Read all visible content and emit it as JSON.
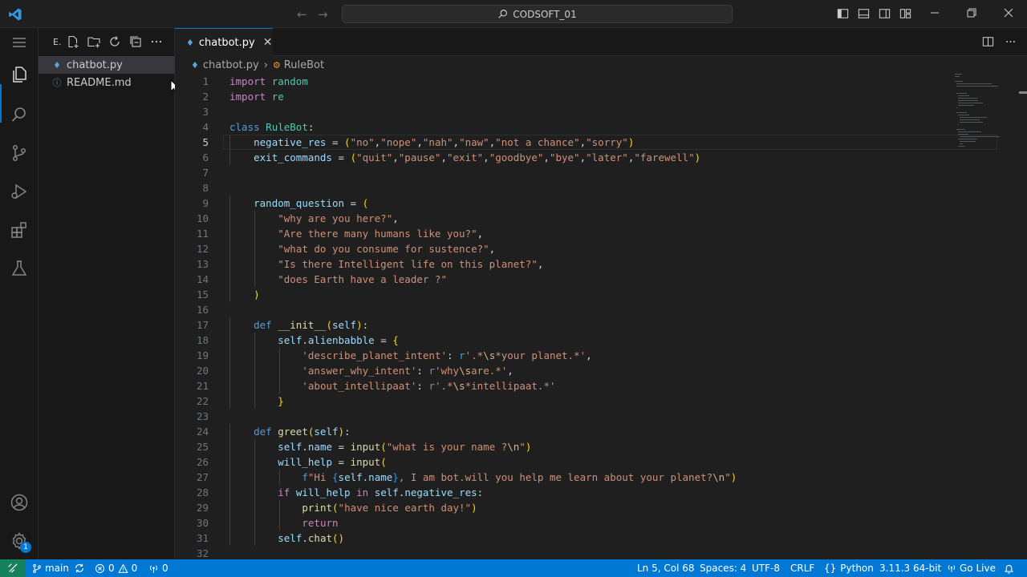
{
  "title_bar": {
    "search_label": "CODSOFT_01"
  },
  "sidebar": {
    "title": "E.",
    "files": [
      {
        "name": "chatbot.py",
        "icon": "python-file-icon"
      },
      {
        "name": "README.md",
        "icon": "info-icon"
      }
    ]
  },
  "editor": {
    "tab_label": "chatbot.py",
    "breadcrumb": {
      "file": "chatbot.py",
      "symbol": "RuleBot"
    },
    "lines": [
      "import random",
      "import re",
      "",
      "class RuleBot:",
      "    negative_res = (\"no\",\"nope\",\"nah\",\"naw\",\"not a chance\",\"sorry\")",
      "    exit_commands = (\"quit\",\"pause\",\"exit\",\"goodbye\",\"bye\",\"later\",\"farewell\")",
      "",
      "",
      "    random_question = (",
      "        \"why are you here?\",",
      "        \"Are there many humans like you?\",",
      "        \"what do you consume for sustence?\",",
      "        \"Is there Intelligent life on this planet?\",",
      "        \"does Earth have a leader ?\"",
      "    )",
      "",
      "    def __init__(self):",
      "        self.alienbabble = {",
      "            'describe_planet_intent': r'.*\\s*your planet.*',",
      "            'answer_why_intent': r'why\\sare.*',",
      "            'about_intellipaat': r'.*\\s*intellipaat.*'",
      "        }",
      "",
      "    def greet(self):",
      "        self.name = input(\"what is your name ?\\n\")",
      "        will_help = input(",
      "            f\"Hi {self.name}, I am bot.will you help me learn about your planet?\\n\")",
      "        if will_help in self.negative_res:",
      "            print(\"have nice earth day!\")",
      "            return",
      "        self.chat()",
      ""
    ],
    "current_line": 5
  },
  "status_bar": {
    "branch": "main",
    "errors": "0",
    "warnings": "0",
    "ports": "0",
    "cursor": "Ln 5, Col 68",
    "spaces": "Spaces: 4",
    "encoding": "UTF-8",
    "eol": "CRLF",
    "language": "Python",
    "interpreter": "3.11.3 64-bit",
    "golive": "Go Live"
  },
  "badges": {
    "accounts_settings": "1"
  },
  "colors": {
    "accent": "#0078d4",
    "remote": "#16825d",
    "editor_bg": "#1f1f1f"
  }
}
